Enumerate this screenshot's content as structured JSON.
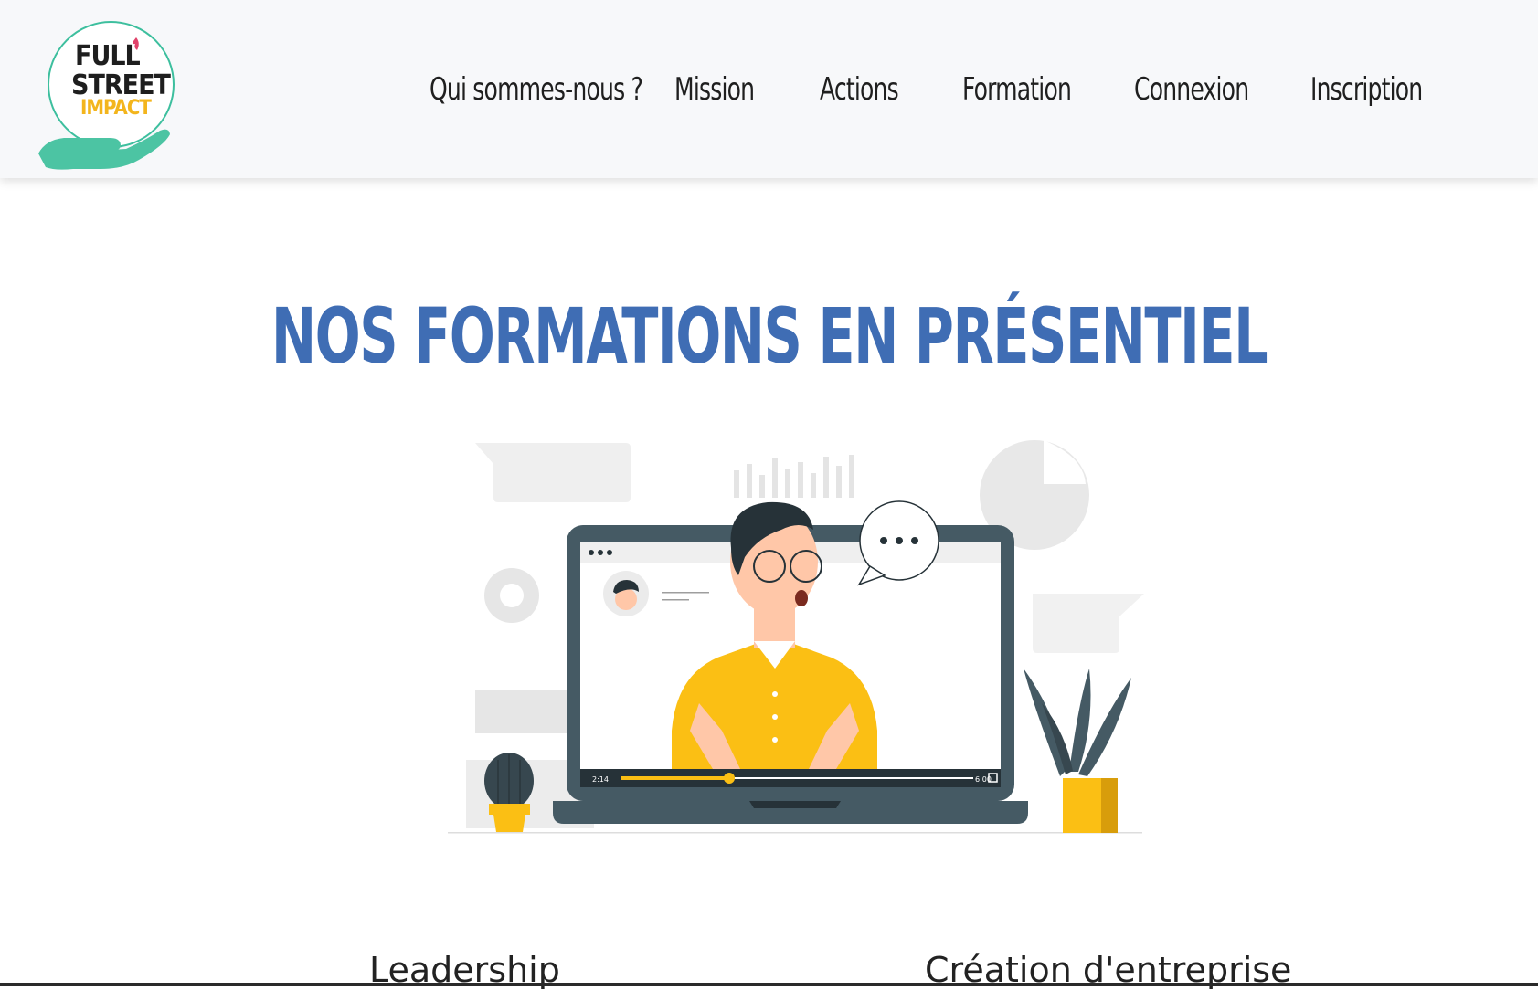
{
  "brand": {
    "logo_line1": "FULL",
    "logo_line2": "STREET",
    "logo_line3": "IMPACT"
  },
  "nav": {
    "items": [
      {
        "label": "Qui sommes-nous ?"
      },
      {
        "label": "Mission"
      },
      {
        "label": "Actions"
      },
      {
        "label": "Formation"
      },
      {
        "label": "Connexion"
      },
      {
        "label": "Inscription"
      }
    ]
  },
  "main": {
    "title": "NOS FORMATIONS EN PRÉSENTIEL",
    "illustration": {
      "video_time_current": "2:14",
      "video_time_total": "6:00"
    },
    "courses": [
      {
        "label": "Leadership"
      },
      {
        "label": "Création d'entreprise"
      }
    ]
  },
  "colors": {
    "accent_blue": "#3f6db4",
    "logo_teal": "#3dbf9e",
    "logo_yellow": "#f3b51d",
    "shirt_yellow": "#fbbf14",
    "laptop_dark": "#455a64"
  }
}
